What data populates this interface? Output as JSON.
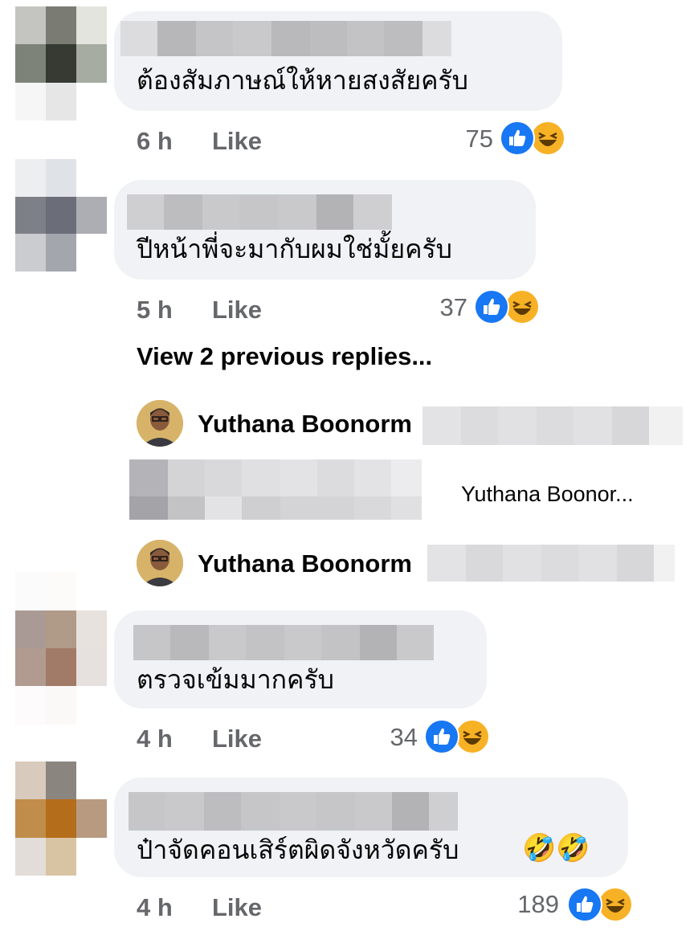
{
  "comments": [
    {
      "text": "ต้องสัมภาษณ์ให้หายสงสัยครับ",
      "time": "6 h",
      "like_label": "Like",
      "reactions": "75"
    },
    {
      "text": "ปีหน้าพี่จะมากับผมใช่มั้ยครับ",
      "time": "5 h",
      "like_label": "Like",
      "reactions": "37"
    },
    {
      "text": "ตรวจเข้มมากครับ",
      "time": "4 h",
      "like_label": "Like",
      "reactions": "34"
    },
    {
      "text": "ป๋าจัดคอนเสิร์ตผิดจังหวัดครับ",
      "emoji": "🤣🤣",
      "time": "4 h",
      "like_label": "Like",
      "reactions": "189"
    }
  ],
  "view_replies": "View 2 previous replies...",
  "replies": [
    {
      "name": "Yuthana Boonorm",
      "preview": "Yuthana Boonor..."
    },
    {
      "name": "Yuthana Boonorm"
    }
  ],
  "colors": {
    "like": "#1877f2",
    "haha": "#f7b125",
    "bubble": "#f0f2f5",
    "meta": "#65676b"
  },
  "icons": [
    "like-reaction-icon",
    "haha-reaction-icon"
  ]
}
